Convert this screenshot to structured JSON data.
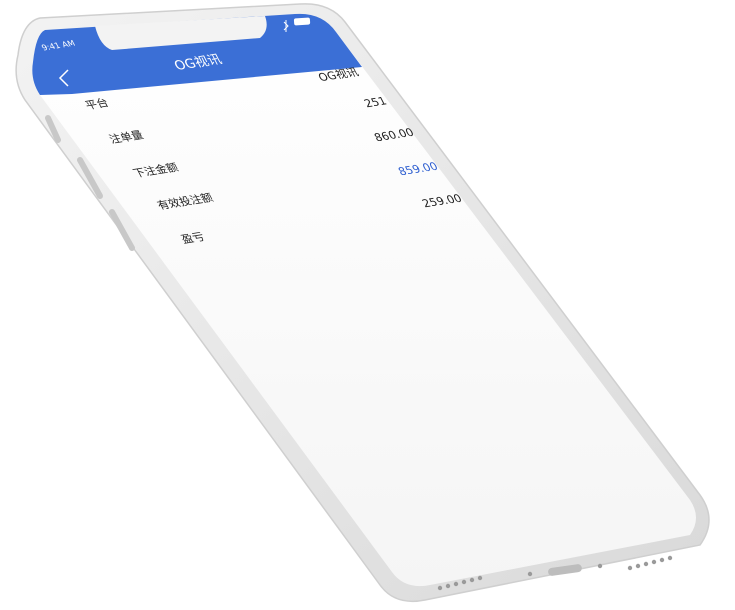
{
  "status_bar": {
    "time": "9:41 AM",
    "bluetooth_icon": "bluetooth-icon",
    "battery_icon": "battery-icon"
  },
  "header": {
    "title": "OG视讯",
    "back_icon": "chevron-left-icon",
    "column_right": "OG视讯",
    "accent": "#3b6fd6"
  },
  "rows": [
    {
      "label": "平台",
      "value": "251"
    },
    {
      "label": "注单量",
      "value": "860.00"
    },
    {
      "label": "下注金额",
      "value": "859.00",
      "highlight": "#2f5fd0"
    },
    {
      "label": "有效投注额",
      "value": "259.00"
    },
    {
      "label": "盈亏",
      "value": ""
    }
  ]
}
